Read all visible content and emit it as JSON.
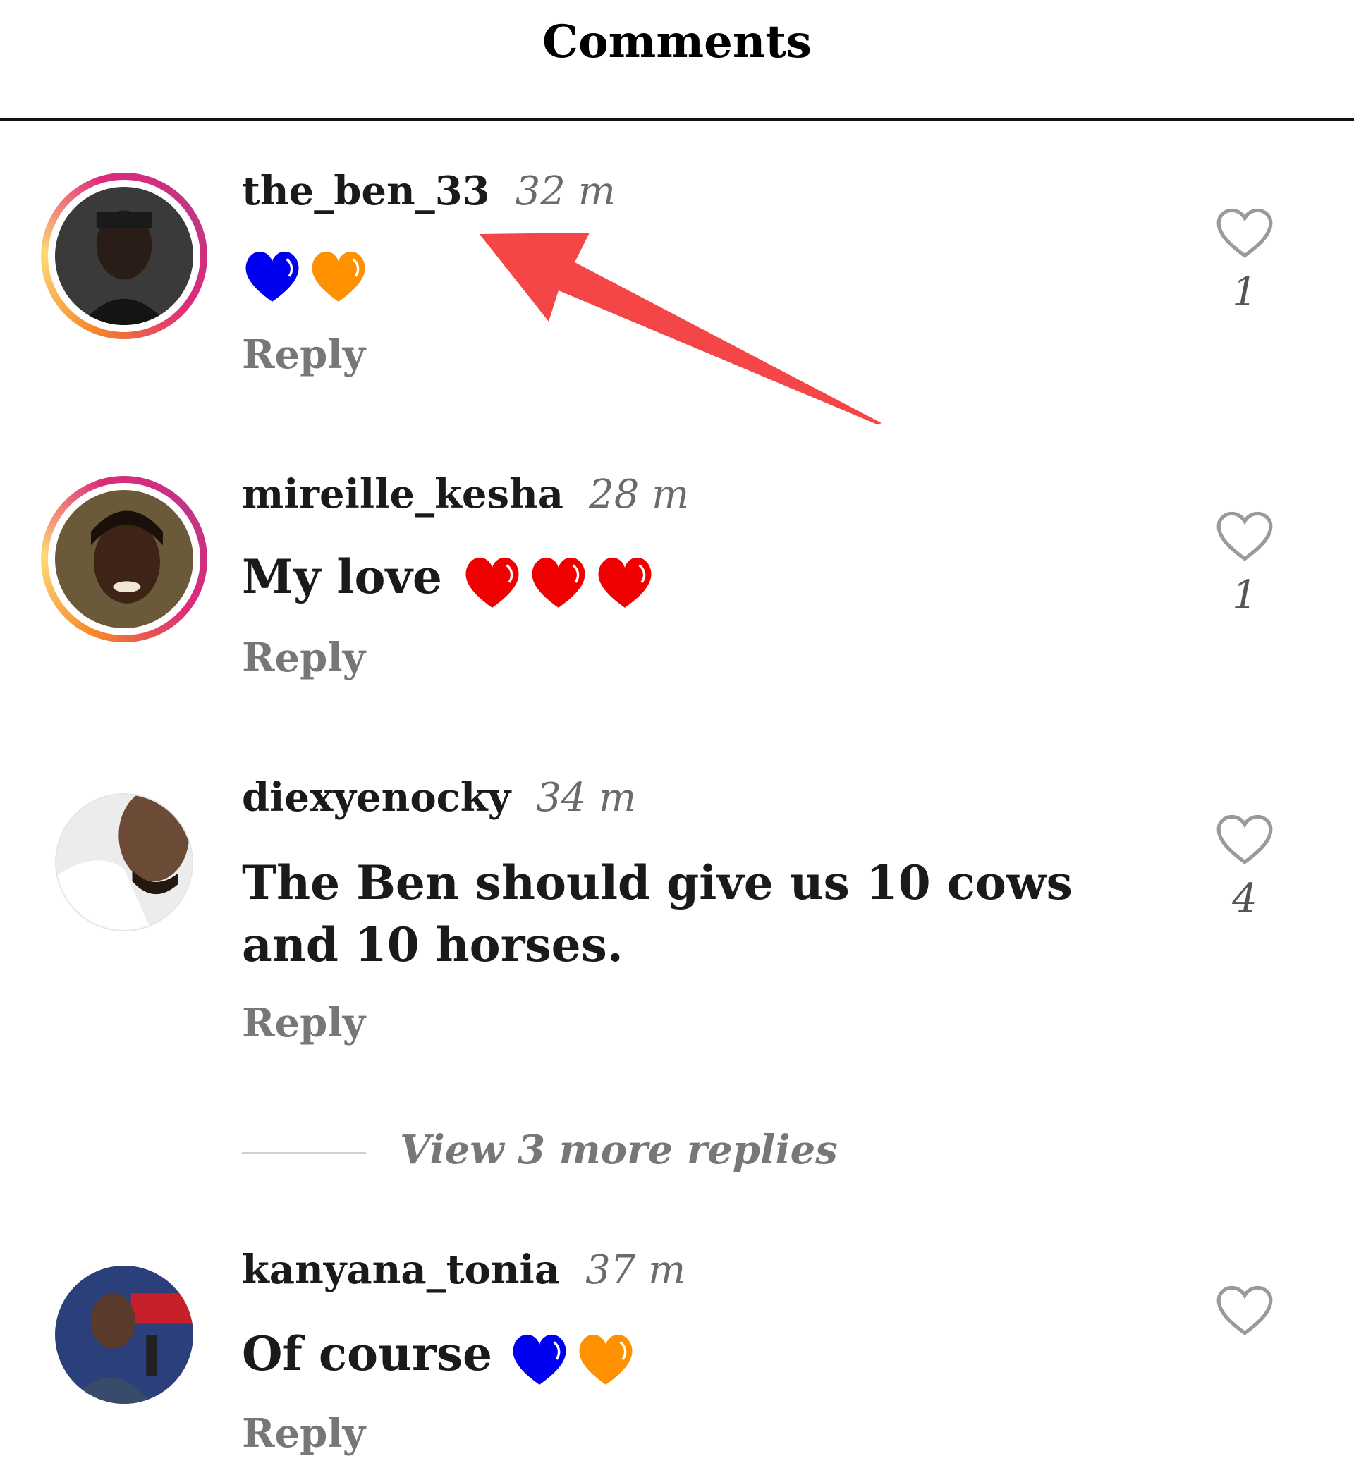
{
  "header": {
    "title": "Comments"
  },
  "colors": {
    "accent_arrow": "#f44646",
    "heart_blue": "#0000f0",
    "heart_orange": "#ff9000",
    "heart_red": "#f00000"
  },
  "comments": [
    {
      "username": "the_ben_33",
      "time": "32 m",
      "text": "",
      "emojis": [
        "blue-heart",
        "orange-heart"
      ],
      "reply_label": "Reply",
      "like_count": "1",
      "story_ring": true
    },
    {
      "username": "mireille_kesha",
      "time": "28 m",
      "text": "My love",
      "emojis": [
        "red-heart",
        "red-heart",
        "red-heart"
      ],
      "reply_label": "Reply",
      "like_count": "1",
      "story_ring": true
    },
    {
      "username": "diexyenocky",
      "time": "34 m",
      "text": "The Ben should give us 10 cows and 10 horses.",
      "emojis": [],
      "reply_label": "Reply",
      "like_count": "4",
      "story_ring": false
    },
    {
      "username": "kanyana_tonia",
      "time": "37 m",
      "text": "Of course",
      "emojis": [
        "blue-heart",
        "orange-heart"
      ],
      "reply_label": "Reply",
      "like_count": "",
      "story_ring": false
    }
  ],
  "view_replies": {
    "label": "View 3 more replies"
  }
}
